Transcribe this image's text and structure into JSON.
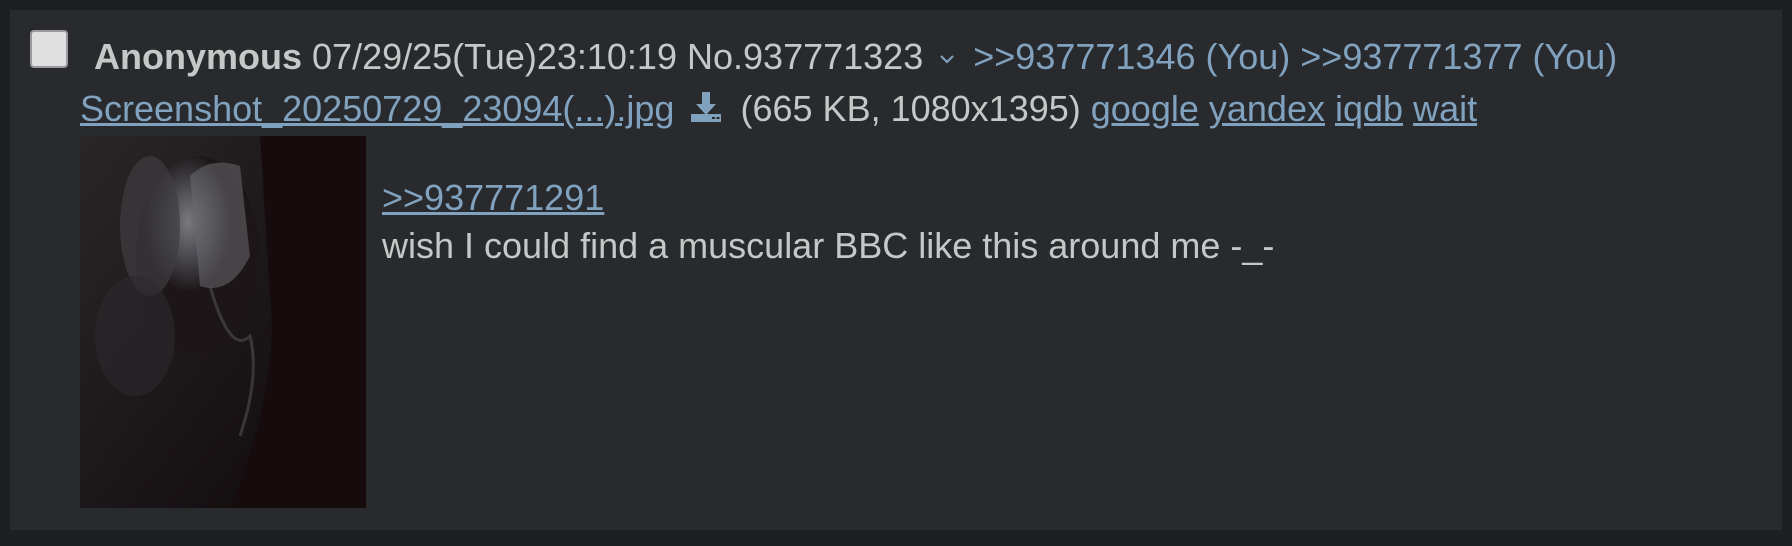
{
  "post": {
    "name": "Anonymous",
    "datetime": "07/29/25(Tue)23:10:19",
    "number": "No.937771323",
    "backlinks": [
      {
        "text": ">>937771346",
        "you": "(You)"
      },
      {
        "text": ">>937771377",
        "you": "(You)"
      }
    ],
    "file": {
      "filename": "Screenshot_20250729_23094(...).jpg",
      "info": "(665 KB, 1080x1395)",
      "search_links": [
        "google",
        "yandex",
        "iqdb",
        "wait"
      ]
    },
    "comment": {
      "quote_link": ">>937771291",
      "text": "wish I could find a muscular BBC like this around me -_-"
    }
  },
  "colors": {
    "page_bg": "#1d1f21",
    "post_bg": "#282a2e",
    "text": "#c5c8c6",
    "link": "#81a2be"
  },
  "icons": {
    "checkbox": "checkbox",
    "menu": "chevron-down-icon",
    "download": "download-icon"
  }
}
